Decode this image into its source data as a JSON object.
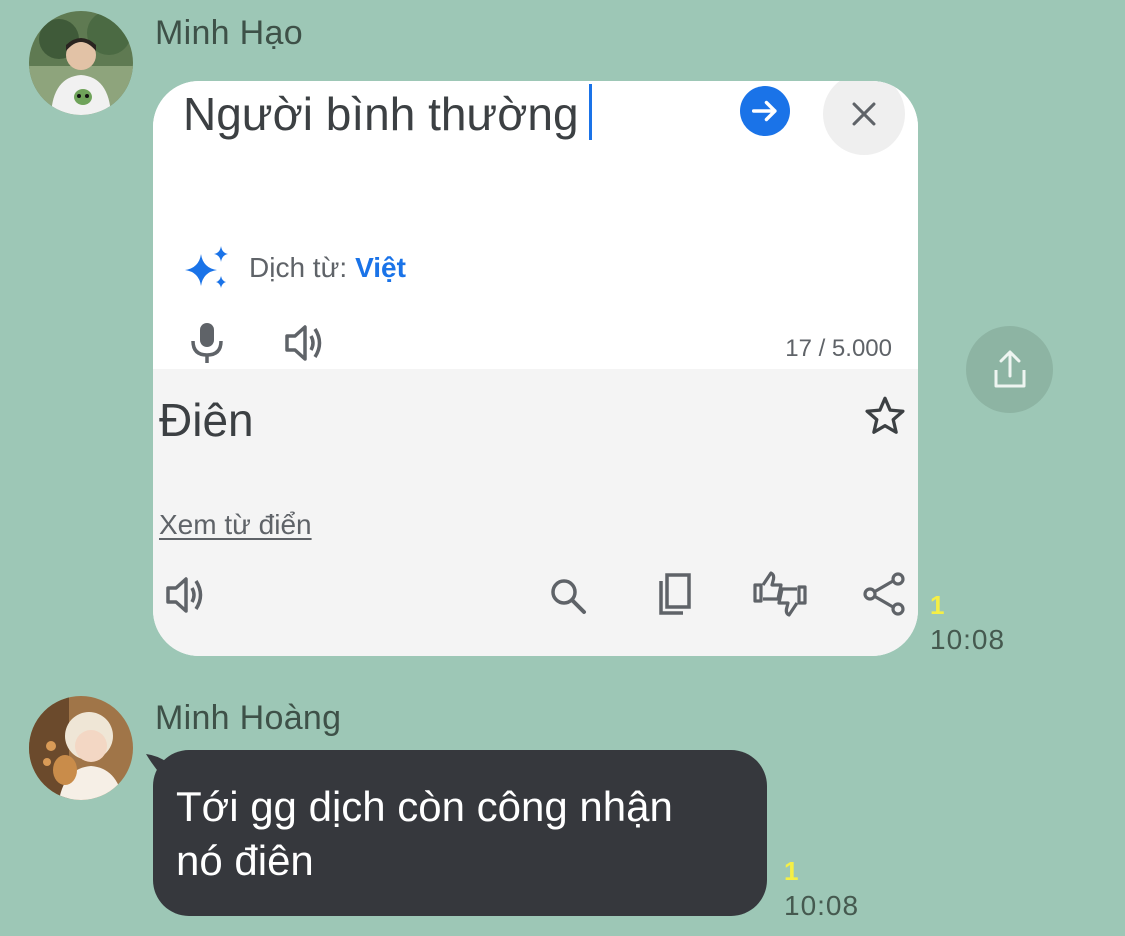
{
  "messages": [
    {
      "sender": "Minh Hạo",
      "avatar_icon": "avatar-photo-icon",
      "type": "image",
      "read_count": "1",
      "time": "10:08",
      "translate_screenshot": {
        "source_text": "Người bình thường",
        "detect_label": "Dịch từ:",
        "detect_language": "Việt",
        "char_count": "17 / 5.000",
        "translation": "Điên",
        "dictionary_link": "Xem từ điển",
        "accent_color": "#1a73e8"
      }
    },
    {
      "sender": "Minh Hoàng",
      "avatar_icon": "avatar-photo-icon",
      "type": "text",
      "text_line1": "Tới gg dịch còn công nhận",
      "text_line2": "nó điên",
      "read_count": "1",
      "time": "10:08",
      "bubble_color": "#36383d"
    }
  ],
  "background_color": "#9dc7b6",
  "read_count_color": "#f5ef45"
}
